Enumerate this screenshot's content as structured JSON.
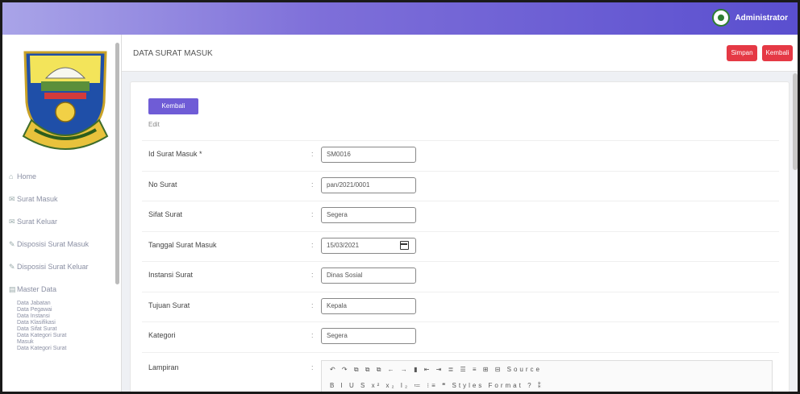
{
  "header": {
    "user_name": "Administrator"
  },
  "sidebar": {
    "items": [
      {
        "icon": "home-icon",
        "label": "Home"
      },
      {
        "icon": "mail-icon",
        "label": "Surat Masuk"
      },
      {
        "icon": "mail-icon",
        "label": "Surat Keluar"
      },
      {
        "icon": "file-icon",
        "label": "Disposisi Surat Masuk"
      },
      {
        "icon": "file-icon",
        "label": "Disposisi Surat Keluar"
      },
      {
        "icon": "folder-icon",
        "label": "Master Data"
      }
    ],
    "subitems": [
      "Data Jabatan",
      "Data Pegawai",
      "Data Instansi",
      "Data Klasifikasi",
      "Data Sifat Surat",
      "Data Kategori Surat",
      "Masuk",
      "Data Kategori Surat"
    ]
  },
  "page": {
    "title": "DATA SURAT MASUK",
    "btn_1": "Simpan",
    "btn_2": "Kembali",
    "back_label": "Kembali",
    "caption": "Edit"
  },
  "form": {
    "rows": [
      {
        "label": "Id Surat Masuk *",
        "value": "SM0016"
      },
      {
        "label": "No Surat",
        "value": "pan/2021/0001"
      },
      {
        "label": "Sifat Surat",
        "value": "Segera"
      },
      {
        "label": "Tanggal Surat Masuk",
        "value": "15/03/2021"
      },
      {
        "label": "Instansi Surat",
        "value": "Dinas Sosial"
      },
      {
        "label": "Tujuan Surat",
        "value": "Kepala"
      },
      {
        "label": "Kategori",
        "value": "Segera"
      },
      {
        "label": "Lampiran",
        "value": ""
      }
    ]
  },
  "editor": {
    "toolbar_1": "↶ ↷ ⧉ ⧉ ⧉ ← → ▮ ⇤ ⇥ ≣ ☰ ≡ ⊞ ⊟ Source",
    "toolbar_2": "B I U S x² x₂ I₂ ≔ ⁝≡ ❝ Styles Format ? ⁑"
  },
  "colors": {
    "accent": "#6f5cd6",
    "danger": "#e53945",
    "topbar_start": "#a9a4e8",
    "topbar_end": "#5a4fcf"
  }
}
